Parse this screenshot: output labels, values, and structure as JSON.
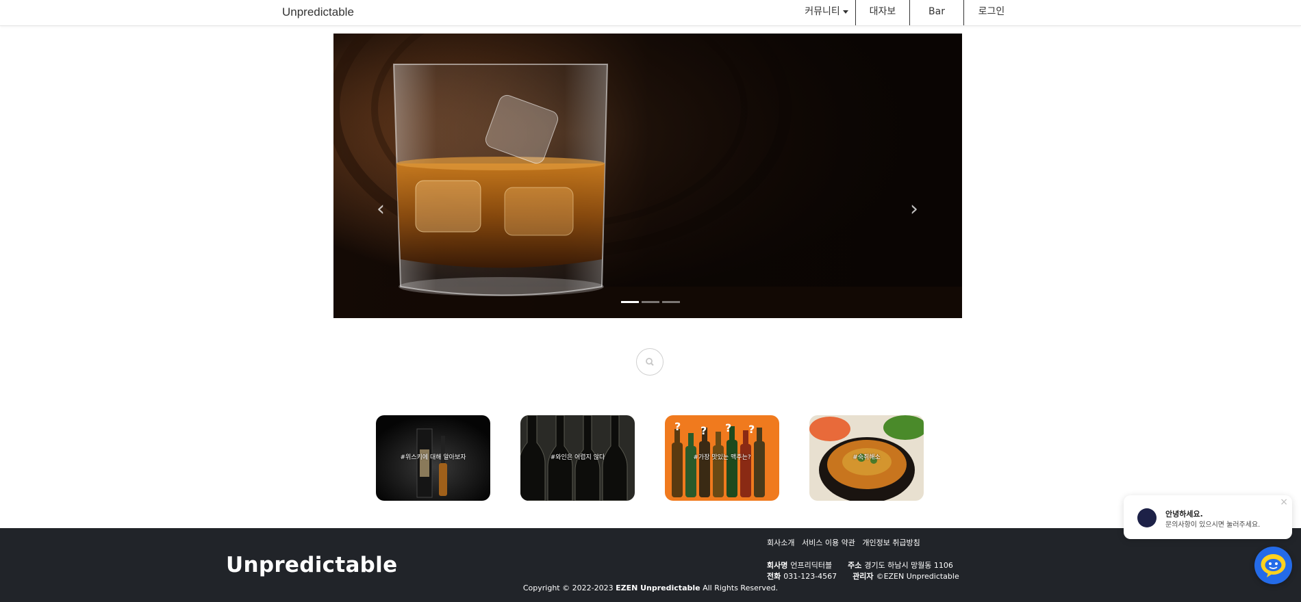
{
  "navbar": {
    "brand": "Unpredictable",
    "items": [
      {
        "label": "커뮤니티"
      },
      {
        "label": "대자보"
      },
      {
        "label": "Bar"
      },
      {
        "label": "로그인"
      }
    ]
  },
  "carousel": {
    "slide_count": 3,
    "active_index": 0
  },
  "search": {
    "icon": "search-icon"
  },
  "cards": [
    {
      "label": "#위스키에 대해 알아보자",
      "bg": "#050505"
    },
    {
      "label": "#와인은 어렵지 않다",
      "bg": "#1a1a18"
    },
    {
      "label": "#가장 맛있는 맥주는?",
      "bg": "#f07a1e"
    },
    {
      "label": "#숙취해소",
      "bg": "#3a2a1c"
    }
  ],
  "footer": {
    "brand": "Unpredictable",
    "links": [
      "회사소개",
      "서비스 이용 약관",
      "개인정보 취급방침"
    ],
    "company_label": "회사명",
    "company_value": "언프리딕터블",
    "address_label": "주소",
    "address_value": "경기도 하남시 망월동 1106",
    "phone_label": "전화",
    "phone_value": "031-123-4567",
    "admin_label": "관리자",
    "admin_value": "©EZEN Unpredictable",
    "copyright_prefix": "Copyright © 2022-2023 ",
    "copyright_brand": "EZEN Unpredictable",
    "copyright_suffix": " All Rights Reserved."
  },
  "chat": {
    "title": "안녕하세요.",
    "message": "문의사항이 있으시면 눌러주세요.",
    "close_icon": "close-icon",
    "launcher_icon": "chat-icon",
    "accent": "#246be8"
  }
}
